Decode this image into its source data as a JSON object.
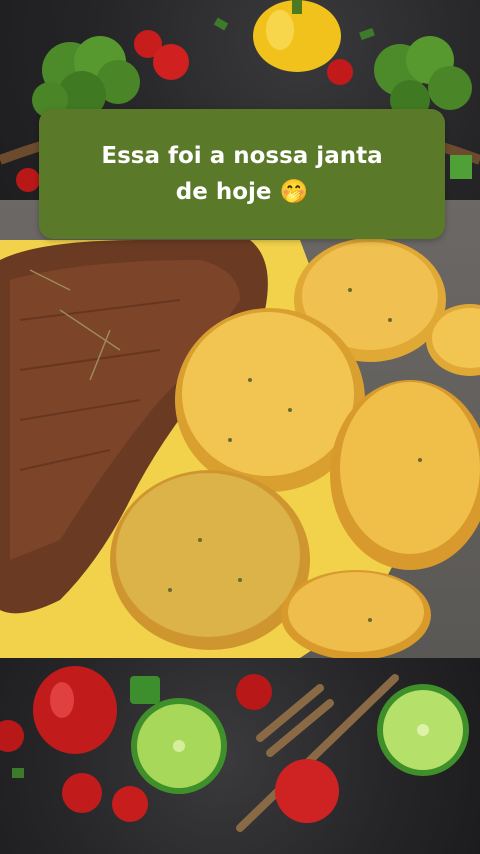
{
  "caption": {
    "text": "Essa foi a nossa janta\nde hoje 🤭"
  },
  "colors": {
    "caption_background": "#5a7a2a",
    "caption_text": "#ffffff"
  },
  "image": {
    "subject": "steak with roasted potato slices in cream sauce"
  }
}
